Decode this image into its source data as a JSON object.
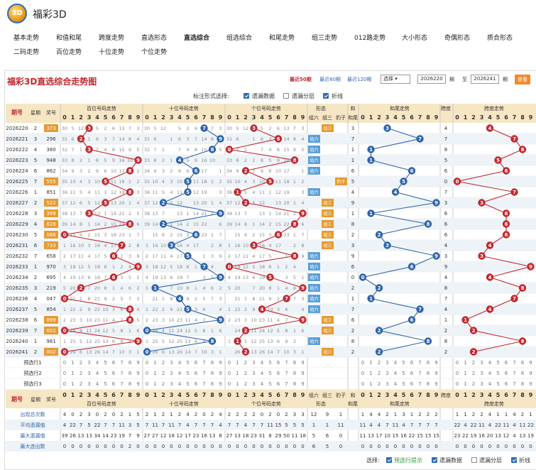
{
  "app": {
    "title": "福彩3D",
    "logo_text": "3D"
  },
  "nav": [
    "基本走势",
    "和值和尾",
    "跨度走势",
    "直选形态",
    "直选综合",
    "组选综合",
    "和尾走势",
    "组三走势",
    "012路走势",
    "大小形态",
    "奇偶形态",
    "质合形态",
    "二码走势",
    "百位走势",
    "十位走势",
    "个位走势"
  ],
  "panel": {
    "title": "福彩3D直选综合走势图",
    "recent": [
      "最近50期",
      "最近80期",
      "最近120期"
    ],
    "select": "选择 ▾",
    "from": "2026220",
    "from_suffix": "期",
    "to_label": "至",
    "to": "2026241",
    "to_suffix": "期",
    "query": "查看"
  },
  "options": {
    "label": "标注形式选择:",
    "items": [
      {
        "label": "遗漏数据",
        "checked": true
      },
      {
        "label": "遗漏分层",
        "checked": false
      },
      {
        "label": "折线",
        "checked": true
      }
    ]
  },
  "headers": {
    "period": "期号",
    "weekday": "星期",
    "prize": "奖号",
    "hundred": "百位号码走势",
    "ten": "十位号码走势",
    "unit": "个位号码走势",
    "shape": "形态",
    "shape_cols": [
      "组六",
      "组三",
      "豹子"
    ],
    "sum": "和",
    "tail": "和尾",
    "sum_trend": "和尾走势",
    "span": "跨度",
    "span_trend": "跨度走势",
    "digits": [
      "0",
      "1",
      "2",
      "3",
      "4",
      "5",
      "6",
      "7",
      "8",
      "9"
    ]
  },
  "chart_data": {
    "type": "table",
    "rows": [
      {
        "period": "2026220",
        "week": "2",
        "prize": "373",
        "h": 3,
        "t": 7,
        "u": 3,
        "shape": "组三",
        "sum": "3",
        "span": 4
      },
      {
        "period": "2026221",
        "week": "3",
        "prize": "296",
        "h": 2,
        "t": 9,
        "u": 6,
        "shape": "组六",
        "sum": "7",
        "span": 7
      },
      {
        "period": "2026222",
        "week": "4",
        "prize": "380",
        "h": 3,
        "t": 8,
        "u": 0,
        "shape": "组六",
        "sum": "1",
        "span": 8
      },
      {
        "period": "2026223",
        "week": "5",
        "prize": "948",
        "h": 9,
        "t": 4,
        "u": 8,
        "shape": "组六",
        "sum": "1",
        "span": 5
      },
      {
        "period": "2026224",
        "week": "6",
        "prize": "862",
        "h": 8,
        "t": 6,
        "u": 2,
        "shape": "组六",
        "sum": "6",
        "span": 6
      },
      {
        "period": "2026225",
        "week": "7",
        "prize": "555",
        "h": 5,
        "t": 5,
        "u": 5,
        "shape": "豹子",
        "sum": "5",
        "span": 0
      },
      {
        "period": "2026226",
        "week": "1",
        "prize": "851",
        "h": 8,
        "t": 5,
        "u": 1,
        "shape": "组六",
        "sum": "4",
        "span": 7
      },
      {
        "period": "2026227",
        "week": "2",
        "prize": "522",
        "h": 5,
        "t": 2,
        "u": 2,
        "shape": "组三",
        "sum": "9",
        "span": 3
      },
      {
        "period": "2026228",
        "week": "3",
        "prize": "399",
        "h": 3,
        "t": 9,
        "u": 9,
        "shape": "组三",
        "sum": "1",
        "span": 6
      },
      {
        "period": "2026229",
        "week": "4",
        "prize": "828",
        "h": 8,
        "t": 2,
        "u": 8,
        "shape": "组三",
        "sum": "8",
        "span": 6
      },
      {
        "period": "2026230",
        "week": "5",
        "prize": "066",
        "h": 0,
        "t": 6,
        "u": 6,
        "shape": "组三",
        "sum": "2",
        "span": 6
      },
      {
        "period": "2026231",
        "week": "6",
        "prize": "733",
        "h": 7,
        "t": 3,
        "u": 3,
        "shape": "组三",
        "sum": "3",
        "span": 4
      },
      {
        "period": "2026232",
        "week": "7",
        "prize": "658",
        "h": 6,
        "t": 5,
        "u": 8,
        "shape": "组六",
        "sum": "9",
        "span": 3
      },
      {
        "period": "2026233",
        "week": "1",
        "prize": "970",
        "h": 9,
        "t": 7,
        "u": 0,
        "shape": "组六",
        "sum": "6",
        "span": 9
      },
      {
        "period": "2026234",
        "week": "2",
        "prize": "695",
        "h": 6,
        "t": 9,
        "u": 5,
        "shape": "组六",
        "sum": "0",
        "span": 4
      },
      {
        "period": "2026235",
        "week": "3",
        "prize": "219",
        "h": 2,
        "t": 1,
        "u": 9,
        "shape": "组六",
        "sum": "2",
        "span": 8
      },
      {
        "period": "2026236",
        "week": "4",
        "prize": "047",
        "h": 0,
        "t": 4,
        "u": 7,
        "shape": "组六",
        "sum": "1",
        "span": 7
      },
      {
        "period": "2026237",
        "week": "5",
        "prize": "854",
        "h": 8,
        "t": 5,
        "u": 4,
        "shape": "组六",
        "sum": "7",
        "span": 4
      },
      {
        "period": "2026238",
        "week": "6",
        "prize": "899",
        "h": 8,
        "t": 9,
        "u": 9,
        "shape": "组三",
        "sum": "6",
        "span": 1
      },
      {
        "period": "2026239",
        "week": "7",
        "prize": "002",
        "h": 0,
        "t": 0,
        "u": 2,
        "shape": "组三",
        "sum": "2",
        "span": 2
      },
      {
        "period": "2026240",
        "week": "1",
        "prize": "981",
        "h": 9,
        "t": 8,
        "u": 1,
        "shape": "组六",
        "sum": "8",
        "span": 8
      },
      {
        "period": "2026241",
        "week": "2",
        "prize": "002",
        "h": 0,
        "t": 0,
        "u": 2,
        "shape": "组三",
        "sum": "2",
        "span": 2
      }
    ]
  },
  "omit_rows": [
    [
      30,
      5,
      12,
      null,
      5,
      2,
      6,
      13,
      7,
      3
    ],
    [
      31,
      6,
      null,
      1,
      6,
      3,
      7,
      14,
      8,
      4
    ],
    [
      32,
      7,
      1,
      null,
      7,
      4,
      8,
      15,
      9,
      5
    ],
    [
      33,
      8,
      2,
      1,
      8,
      5,
      9,
      16,
      10,
      null
    ],
    [
      34,
      9,
      3,
      2,
      9,
      6,
      10,
      17,
      null,
      1
    ],
    [
      35,
      10,
      4,
      3,
      10,
      null,
      11,
      18,
      1,
      2
    ],
    [
      36,
      11,
      5,
      4,
      11,
      1,
      12,
      19,
      null,
      3
    ],
    [
      37,
      12,
      6,
      5,
      12,
      null,
      13,
      20,
      1,
      4
    ],
    [
      38,
      13,
      7,
      null,
      13,
      1,
      14,
      21,
      2,
      5
    ],
    [
      39,
      14,
      8,
      1,
      14,
      2,
      15,
      22,
      null,
      6
    ],
    [
      null,
      15,
      9,
      2,
      15,
      3,
      16,
      23,
      1,
      7
    ],
    [
      1,
      16,
      10,
      3,
      16,
      4,
      17,
      null,
      2,
      8
    ],
    [
      2,
      17,
      11,
      4,
      17,
      5,
      null,
      1,
      3,
      9
    ],
    [
      3,
      18,
      12,
      5,
      18,
      6,
      1,
      2,
      4,
      null
    ],
    [
      4,
      19,
      13,
      6,
      19,
      7,
      null,
      3,
      5,
      1
    ],
    [
      5,
      20,
      null,
      7,
      20,
      8,
      1,
      4,
      6,
      2
    ],
    [
      null,
      21,
      1,
      8,
      21,
      9,
      2,
      5,
      7,
      3
    ],
    [
      1,
      22,
      2,
      9,
      22,
      10,
      3,
      6,
      null,
      4
    ],
    [
      2,
      23,
      3,
      10,
      23,
      11,
      4,
      7,
      null,
      5
    ],
    [
      null,
      24,
      4,
      11,
      24,
      12,
      5,
      8,
      1,
      6
    ],
    [
      1,
      25,
      5,
      12,
      25,
      13,
      6,
      9,
      2,
      null
    ],
    [
      null,
      26,
      6,
      13,
      26,
      14,
      7,
      10,
      3,
      1
    ]
  ],
  "forecast": [
    "预选行1",
    "预选行2",
    "预选行3"
  ],
  "stats": {
    "labels": [
      "出现总次数",
      "平均遗漏值",
      "最大遗漏值",
      "最大连出数"
    ],
    "h": [
      [
        4,
        0,
        2,
        3,
        0,
        2,
        0,
        2,
        1,
        5,
        3
      ],
      [
        4,
        22,
        7,
        5,
        22,
        7,
        7,
        11,
        3,
        5
      ],
      [
        39,
        26,
        13,
        13,
        34,
        14,
        23,
        19,
        7,
        9
      ],
      [
        0,
        0,
        0,
        0,
        0,
        0,
        0,
        0,
        2,
        0
      ]
    ],
    "t": [
      [
        2,
        1,
        2,
        1,
        2,
        4,
        2,
        0,
        2,
        4
      ],
      [
        7,
        11,
        7,
        11,
        7,
        4,
        7,
        7,
        7,
        4
      ],
      [
        27,
        27,
        12,
        18,
        12,
        17,
        23,
        16,
        13,
        8
      ],
      [
        0,
        0,
        0,
        0,
        0,
        0,
        0,
        0,
        0,
        0
      ]
    ],
    "u": [
      [
        2,
        2,
        2,
        2,
        0,
        2,
        0,
        2,
        3,
        3
      ],
      [
        7,
        7,
        4,
        7,
        7,
        11,
        15,
        5,
        5,
        5
      ],
      [
        27,
        13,
        18,
        23,
        31,
        8,
        29,
        50,
        11,
        18
      ],
      [
        0,
        0,
        0,
        0,
        0,
        0,
        0,
        0,
        0,
        0
      ]
    ],
    "shape": [
      [
        12,
        9,
        1
      ],
      [
        1,
        1,
        11
      ],
      [
        5,
        6,
        0
      ],
      [
        6,
        5,
        0
      ]
    ],
    "sum": [
      [
        1,
        4,
        4,
        2,
        1,
        3,
        1,
        2,
        2,
        2
      ],
      [
        11,
        4,
        4,
        7,
        11,
        4,
        7,
        7,
        7,
        7
      ],
      [
        11,
        13,
        17,
        10,
        15,
        16,
        22,
        15,
        15,
        15
      ],
      [
        0,
        0,
        0,
        0,
        0,
        0,
        0,
        0,
        0,
        0
      ]
    ],
    "span": [
      [
        1,
        1,
        2,
        2,
        4,
        1,
        1,
        4,
        2,
        1
      ],
      [
        22,
        4,
        22,
        11,
        4,
        22,
        11,
        4,
        11,
        22
      ],
      [
        23,
        22,
        19,
        16,
        20,
        13,
        12,
        4,
        13,
        19
      ],
      [
        0,
        0,
        0,
        0,
        0,
        0,
        0,
        0,
        0,
        0
      ]
    ]
  },
  "footer": {
    "label": "选择:",
    "items": [
      {
        "label": "预选行提示",
        "checked": true,
        "green": true
      },
      {
        "label": "遗漏数据",
        "checked": true
      },
      {
        "label": "遗漏分层",
        "checked": false
      },
      {
        "label": "折线",
        "checked": true
      }
    ]
  },
  "colors": {
    "red": "#c0282e",
    "blue": "#2e64a8",
    "header": "#f6e6c4",
    "prize": "#e69a2f",
    "stripe": "#eef3f8"
  }
}
